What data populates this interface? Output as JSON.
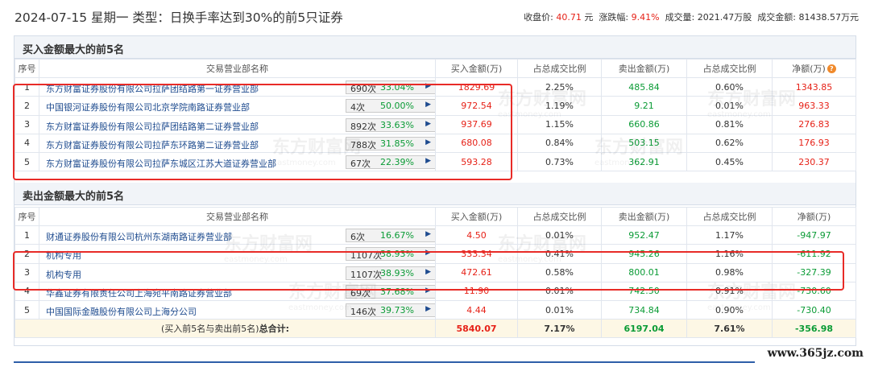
{
  "header": {
    "title": "2024-07-15 星期一 类型：日换手率达到30%的前5只证券",
    "close_label": "收盘价:",
    "close_value": "40.71",
    "close_unit": "元",
    "change_label": "涨跌幅:",
    "change_value": "9.41%",
    "volume_label": "成交量:",
    "volume_value": "2021.47万股",
    "amount_label": "成交金额:",
    "amount_value": "81438.57万元"
  },
  "buy_section": {
    "title": "买入金额最大的前5名",
    "columns": [
      "序号",
      "交易营业部名称",
      "买入金额(万)",
      "占总成交比例",
      "卖出金额(万)",
      "占总成交比例",
      "净额(万)"
    ],
    "rows": [
      {
        "idx": "1",
        "name": "东方财富证券股份有限公司拉萨团结路第一证券营业部",
        "count": "690次",
        "pct": "33.04%",
        "badge": "?",
        "buy": "1829.69",
        "buy_ratio": "2.25%",
        "sell": "485.84",
        "sell_ratio": "0.60%",
        "net": "1343.85"
      },
      {
        "idx": "2",
        "name": "中国银河证券股份有限公司北京学院南路证券营业部",
        "count": "4次",
        "pct": "50.00%",
        "buy": "972.54",
        "buy_ratio": "1.19%",
        "sell": "9.21",
        "sell_ratio": "0.01%",
        "net": "963.33"
      },
      {
        "idx": "3",
        "name": "东方财富证券股份有限公司拉萨团结路第二证券营业部",
        "count": "892次",
        "pct": "33.63%",
        "buy": "937.69",
        "buy_ratio": "1.15%",
        "sell": "660.86",
        "sell_ratio": "0.81%",
        "net": "276.83"
      },
      {
        "idx": "4",
        "name": "东方财富证券股份有限公司拉萨东环路第二证券营业部",
        "count": "788次",
        "pct": "31.85%",
        "buy": "680.08",
        "buy_ratio": "0.84%",
        "sell": "503.15",
        "sell_ratio": "0.62%",
        "net": "176.93"
      },
      {
        "idx": "5",
        "name": "东方财富证券股份有限公司拉萨东城区江苏大道证券营业部",
        "count": "67次",
        "pct": "22.39%",
        "buy": "593.28",
        "buy_ratio": "0.73%",
        "sell": "362.91",
        "sell_ratio": "0.45%",
        "net": "230.37"
      }
    ]
  },
  "sell_section": {
    "title": "卖出金额最大的前5名",
    "columns": [
      "序号",
      "交易营业部名称",
      "买入金额(万)",
      "占总成交比例",
      "卖出金额(万)",
      "占总成交比例",
      "净额(万)"
    ],
    "rows": [
      {
        "idx": "1",
        "name": "财通证券股份有限公司杭州东湖南路证券营业部",
        "count": "6次",
        "pct": "16.67%",
        "badge": "?",
        "buy": "4.50",
        "buy_ratio": "0.01%",
        "sell": "952.47",
        "sell_ratio": "1.17%",
        "net": "-947.97"
      },
      {
        "idx": "2",
        "name": "机构专用",
        "count": "1107次",
        "pct": "38.93%",
        "buy": "333.34",
        "buy_ratio": "0.41%",
        "sell": "945.26",
        "sell_ratio": "1.16%",
        "net": "-611.92"
      },
      {
        "idx": "3",
        "name": "机构专用",
        "count": "1107次",
        "pct": "38.93%",
        "buy": "472.61",
        "buy_ratio": "0.58%",
        "sell": "800.01",
        "sell_ratio": "0.98%",
        "net": "-327.39"
      },
      {
        "idx": "4",
        "name": "华鑫证券有限责任公司上海宛平南路证券营业部",
        "count": "69次",
        "pct": "37.68%",
        "buy": "11.90",
        "buy_ratio": "0.01%",
        "sell": "742.50",
        "sell_ratio": "0.91%",
        "net": "-730.60"
      },
      {
        "idx": "5",
        "name": "中国国际金融股份有限公司上海分公司",
        "count": "146次",
        "pct": "39.73%",
        "buy": "4.44",
        "buy_ratio": "0.01%",
        "sell": "734.84",
        "sell_ratio": "0.90%",
        "net": "-730.40"
      }
    ],
    "total": {
      "label_prefix": "(买入前5名与卖出前5名)",
      "label_bold": "总合计:",
      "buy": "5840.07",
      "buy_ratio": "7.17%",
      "sell": "6197.04",
      "sell_ratio": "7.61%",
      "net": "-356.98"
    }
  },
  "watermark": {
    "text": "东方财富网",
    "sub": "eastmoney.com"
  },
  "site_url": "www.365jz.com",
  "colors": {
    "red": "#e62117",
    "green": "#0a9b35",
    "orange": "#f08a2c",
    "highlight": "#e82b27",
    "link": "#1e4b8f"
  }
}
